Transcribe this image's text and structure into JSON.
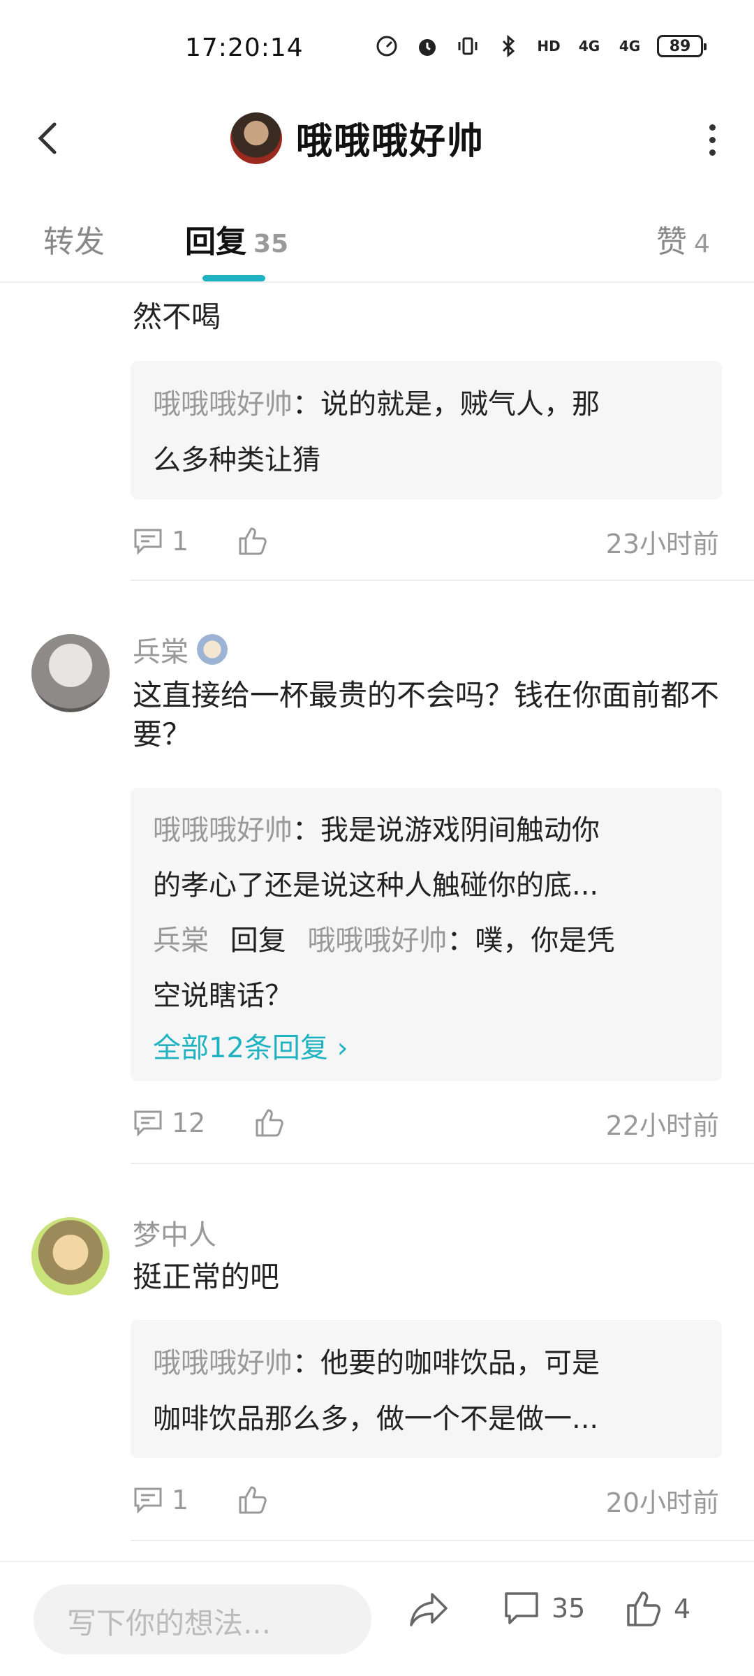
{
  "status": {
    "time": "17:20:14",
    "battery": "89",
    "hd": "HD",
    "sig1": "4G",
    "sig2": "4G"
  },
  "header": {
    "title": "哦哦哦好帅"
  },
  "tabs": {
    "forward": "转发",
    "reply": "回复",
    "reply_count": "35",
    "like": "赞",
    "like_count": "4"
  },
  "comments": [
    {
      "text": "然不喝",
      "reply_lines": [
        {
          "who": "哦哦哦好帅",
          "text": "：说的就是，贼气人，那"
        },
        {
          "who": "",
          "text": "么多种类让猜"
        }
      ],
      "reply_count": "1",
      "time": "23小时前"
    },
    {
      "name": "兵棠",
      "text": "这直接给一杯最贵的不会吗？钱在你面前都不要？",
      "reply_lines": [
        {
          "who": "哦哦哦好帅",
          "text": "：我是说游戏阴间触动你"
        },
        {
          "who": "",
          "text": "的孝心了还是说这种人触碰你的底..."
        },
        {
          "who": "兵棠",
          "mid": "回复",
          "who2": "哦哦哦好帅",
          "text": "：噗，你是凭"
        },
        {
          "who": "",
          "text": "空说瞎话？"
        }
      ],
      "all_replies": "全部12条回复",
      "reply_count": "12",
      "time": "22小时前"
    },
    {
      "name": "梦中人",
      "text": "挺正常的吧",
      "reply_lines": [
        {
          "who": "哦哦哦好帅",
          "text": "：他要的咖啡饮品，可是"
        },
        {
          "who": "",
          "text": "咖啡饮品那么多，做一个不是做一..."
        }
      ],
      "reply_count": "1",
      "time": "20小时前"
    }
  ],
  "bottom": {
    "placeholder": "写下你的想法...",
    "comment_count": "35",
    "like_count": "4"
  },
  "colors": {
    "accent": "#1fb3c2"
  }
}
